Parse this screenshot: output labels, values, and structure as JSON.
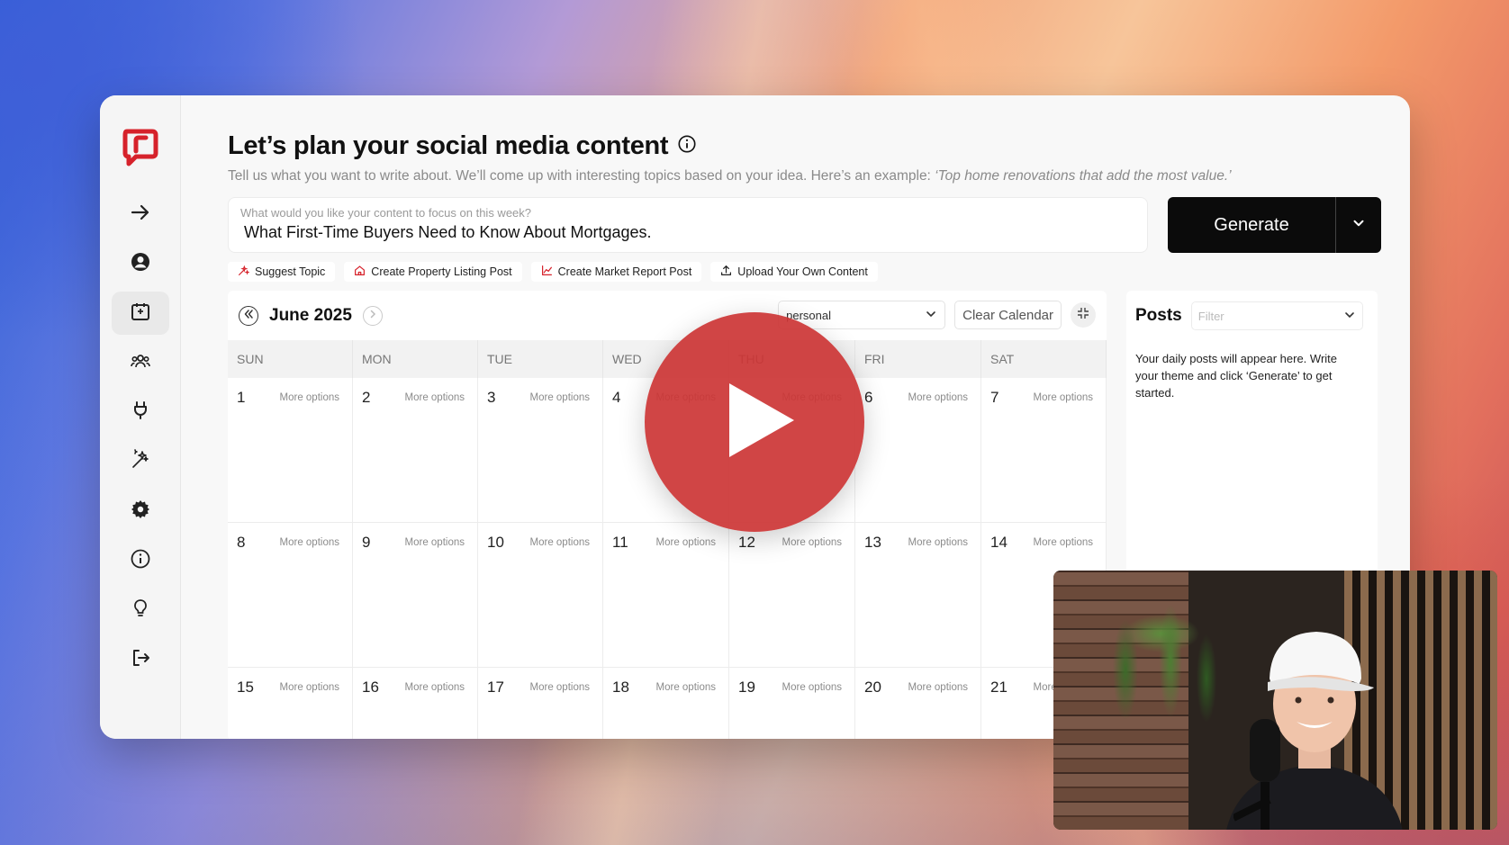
{
  "header": {
    "title": "Let’s plan your social media content",
    "subtitle_prefix": "Tell us what you want to write about. We’ll come up with interesting topics based on your idea. Here’s an example: ",
    "subtitle_example": "‘Top home renovations that add the most value.’"
  },
  "focus_input": {
    "label": "What would you like your content to focus on this week?",
    "value": "What First-Time Buyers Need to Know About Mortgages."
  },
  "generate": {
    "label": "Generate"
  },
  "chips": [
    {
      "label": "Suggest Topic",
      "icon": "sparkle-icon"
    },
    {
      "label": "Create Property Listing Post",
      "icon": "home-icon"
    },
    {
      "label": "Create Market Report Post",
      "icon": "chart-icon"
    },
    {
      "label": "Upload Your Own Content",
      "icon": "upload-icon"
    }
  ],
  "calendar": {
    "month": "June 2025",
    "account_select": "personal",
    "clear_label": "Clear Calendar",
    "days_of_week": [
      "SUN",
      "MON",
      "TUE",
      "WED",
      "THU",
      "FRI",
      "SAT"
    ],
    "more_options": "More options",
    "weeks": [
      [
        "1",
        "2",
        "3",
        "4",
        "5",
        "6",
        "7"
      ],
      [
        "8",
        "9",
        "10",
        "11",
        "12",
        "13",
        "14"
      ],
      [
        "15",
        "16",
        "17",
        "18",
        "19",
        "20",
        "21"
      ]
    ]
  },
  "posts": {
    "title": "Posts",
    "filter_placeholder": "Filter",
    "empty_message": "Your daily posts will appear here. Write your theme and click ‘Generate’ to get started."
  },
  "sidebar": {
    "items": [
      {
        "icon": "arrow-right-icon"
      },
      {
        "icon": "user-icon"
      },
      {
        "icon": "calendar-icon",
        "active": true
      },
      {
        "icon": "team-icon"
      },
      {
        "icon": "plug-icon"
      },
      {
        "icon": "magic-wand-icon"
      },
      {
        "icon": "gear-icon"
      },
      {
        "icon": "info-icon"
      },
      {
        "icon": "lightbulb-icon"
      },
      {
        "icon": "logout-icon"
      }
    ]
  },
  "colors": {
    "brand_red": "#d6222b",
    "play_red": "#cc3535",
    "button_black": "#0b0b0b"
  }
}
